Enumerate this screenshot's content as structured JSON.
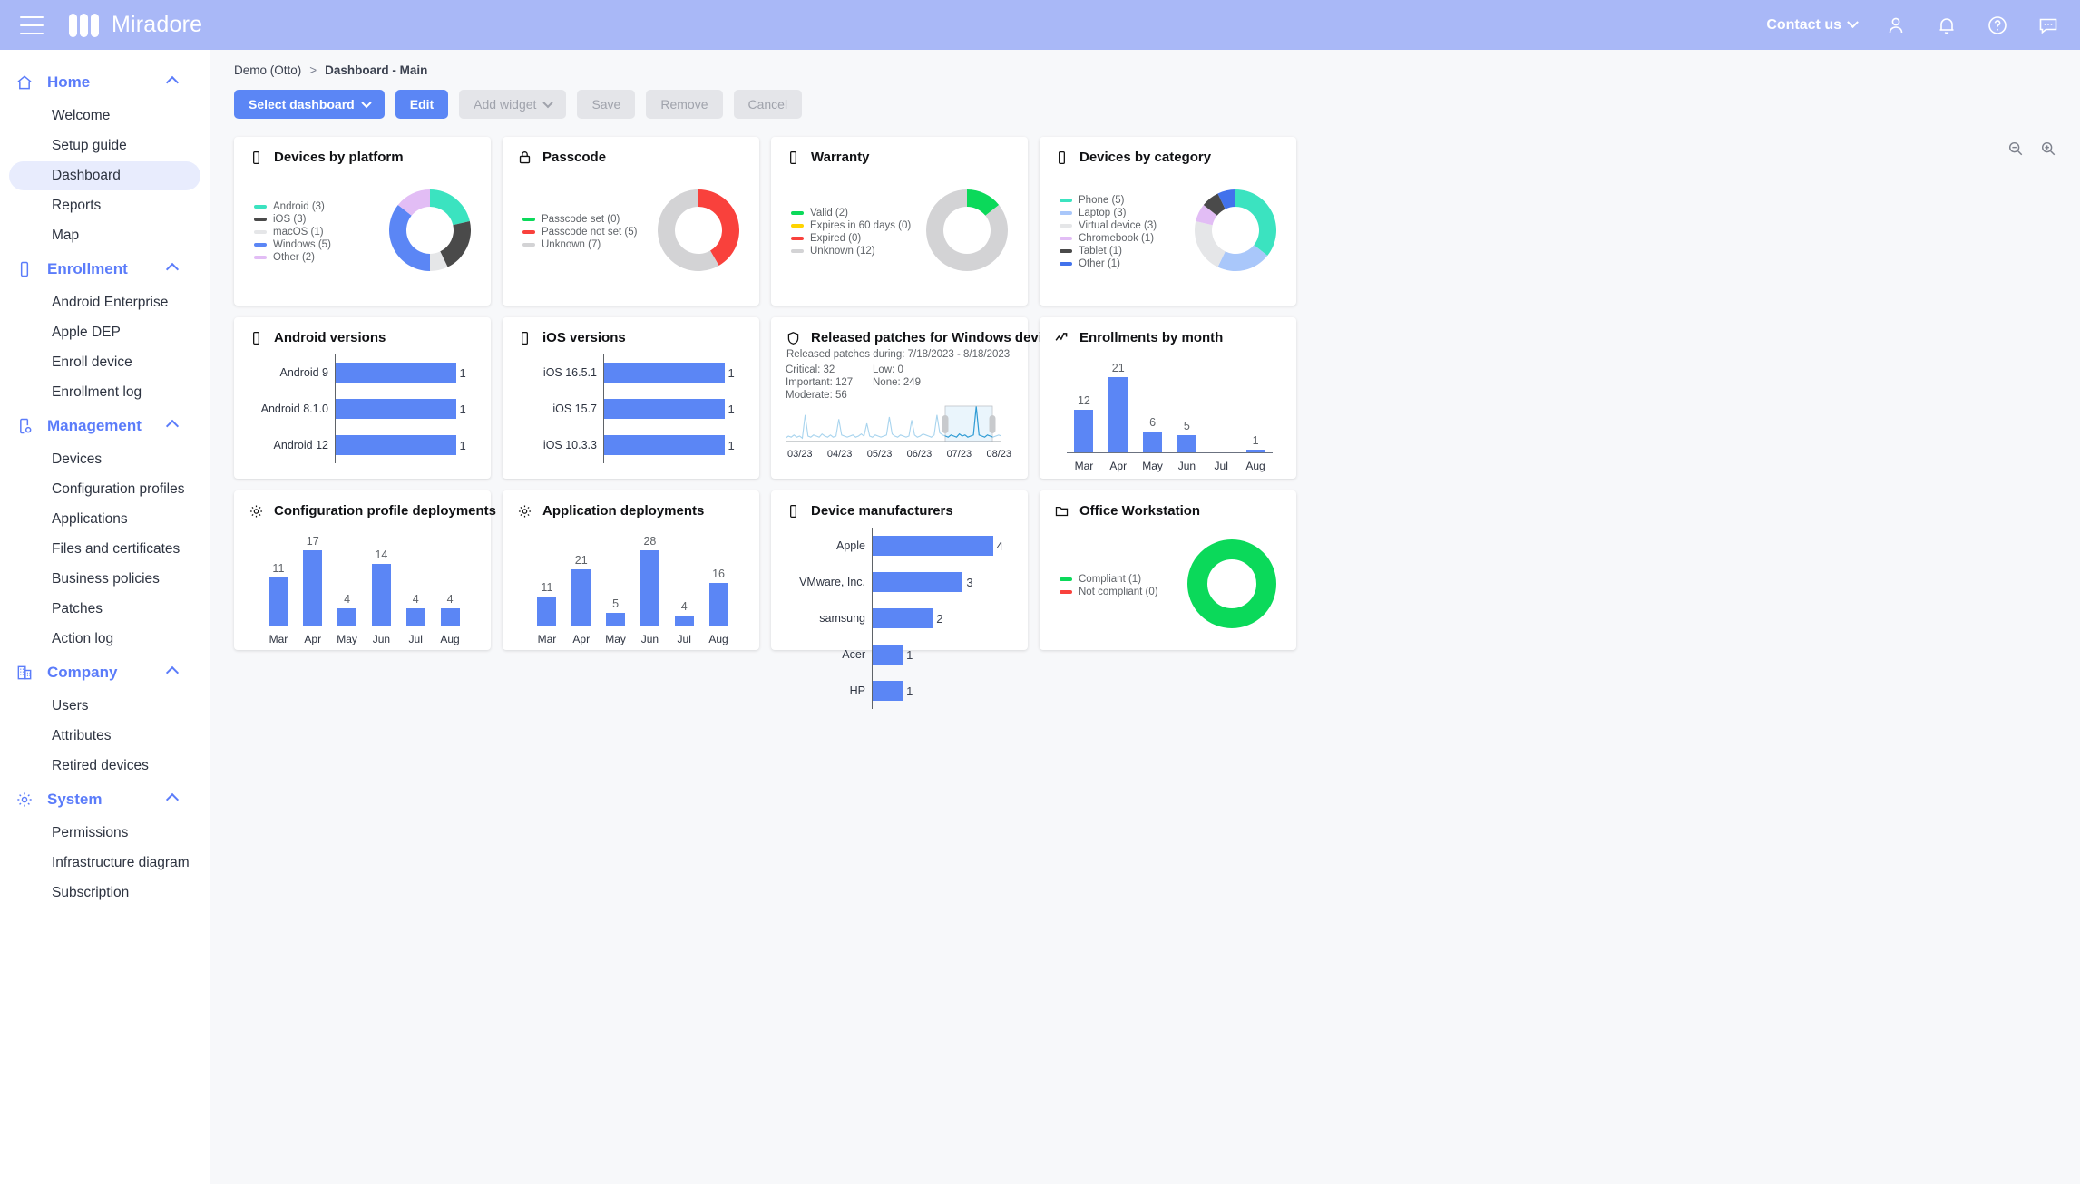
{
  "topbar": {
    "brand": "Miradore",
    "contact_label": "Contact us",
    "icons": [
      "menu-icon",
      "user-icon",
      "bell-icon",
      "help-icon",
      "chat-icon"
    ]
  },
  "sidebar": {
    "groups": [
      {
        "label": "Home",
        "icon": "home-icon",
        "items": [
          {
            "label": "Welcome",
            "active": false
          },
          {
            "label": "Setup guide",
            "active": false
          },
          {
            "label": "Dashboard",
            "active": true
          },
          {
            "label": "Reports",
            "active": false
          },
          {
            "label": "Map",
            "active": false
          }
        ]
      },
      {
        "label": "Enrollment",
        "icon": "device-icon",
        "items": [
          {
            "label": "Android Enterprise",
            "active": false
          },
          {
            "label": "Apple DEP",
            "active": false
          },
          {
            "label": "Enroll device",
            "active": false
          },
          {
            "label": "Enrollment log",
            "active": false
          }
        ]
      },
      {
        "label": "Management",
        "icon": "device-cog-icon",
        "items": [
          {
            "label": "Devices",
            "active": false
          },
          {
            "label": "Configuration profiles",
            "active": false
          },
          {
            "label": "Applications",
            "active": false
          },
          {
            "label": "Files and certificates",
            "active": false
          },
          {
            "label": "Business policies",
            "active": false
          },
          {
            "label": "Patches",
            "active": false
          },
          {
            "label": "Action log",
            "active": false
          }
        ]
      },
      {
        "label": "Company",
        "icon": "building-icon",
        "items": [
          {
            "label": "Users",
            "active": false
          },
          {
            "label": "Attributes",
            "active": false
          },
          {
            "label": "Retired devices",
            "active": false
          }
        ]
      },
      {
        "label": "System",
        "icon": "gear-icon",
        "items": [
          {
            "label": "Permissions",
            "active": false
          },
          {
            "label": "Infrastructure diagram",
            "active": false
          },
          {
            "label": "Subscription",
            "active": false
          }
        ]
      }
    ]
  },
  "breadcrumb": {
    "root": "Demo (Otto)",
    "separator": ">",
    "current": "Dashboard - Main"
  },
  "toolbar": {
    "select_dashboard": "Select dashboard",
    "edit": "Edit",
    "add_widget": "Add widget",
    "save": "Save",
    "remove": "Remove",
    "cancel": "Cancel",
    "zoom_out_icon": "zoom-out-icon",
    "zoom_in_icon": "zoom-in-icon"
  },
  "colors": {
    "brand_blue": "#5B86F5",
    "header_blue": "#A9B8F7",
    "teal": "#3BE3C0",
    "dark_gray": "#4A4A4A",
    "light_gray": "#E5E6E8",
    "violet": "#E2BDF5",
    "green": "#0BD95A",
    "red": "#F9413C",
    "yellow": "#FFD400",
    "lilac": "#A9C7FA"
  },
  "chart_data": [
    {
      "id": "devices-by-platform",
      "type": "pie",
      "title": "Devices by platform",
      "icon": "device-icon",
      "legend_position": "left",
      "labels": [
        "Android (3)",
        "iOS (3)",
        "macOS (1)",
        "Windows (5)",
        "Other (2)"
      ],
      "categories": [
        "Android",
        "iOS",
        "macOS",
        "Windows",
        "Other"
      ],
      "values": [
        3,
        3,
        1,
        5,
        2
      ],
      "colors": [
        "#3BE3C0",
        "#4A4A4A",
        "#E5E6E8",
        "#5B86F5",
        "#E2BDF5"
      ]
    },
    {
      "id": "passcode",
      "type": "pie",
      "title": "Passcode",
      "icon": "lock-icon",
      "legend_position": "left",
      "labels": [
        "Passcode set (0)",
        "Passcode not set (5)",
        "Unknown (7)"
      ],
      "categories": [
        "Passcode set",
        "Passcode not set",
        "Unknown"
      ],
      "values": [
        0,
        5,
        7
      ],
      "colors": [
        "#0BD95A",
        "#F9413C",
        "#D3D3D5"
      ]
    },
    {
      "id": "warranty",
      "type": "pie",
      "title": "Warranty",
      "icon": "device-icon",
      "legend_position": "left",
      "labels": [
        "Valid (2)",
        "Expires in 60 days (0)",
        "Expired (0)",
        "Unknown (12)"
      ],
      "categories": [
        "Valid",
        "Expires in 60 days",
        "Expired",
        "Unknown"
      ],
      "values": [
        2,
        0,
        0,
        12
      ],
      "colors": [
        "#0BD95A",
        "#FFD400",
        "#F9413C",
        "#D3D3D5"
      ]
    },
    {
      "id": "devices-by-category",
      "type": "pie",
      "title": "Devices by category",
      "icon": "device-icon",
      "legend_position": "left",
      "labels": [
        "Phone (5)",
        "Laptop (3)",
        "Virtual device (3)",
        "Chromebook (1)",
        "Tablet (1)",
        "Other (1)"
      ],
      "categories": [
        "Phone",
        "Laptop",
        "Virtual device",
        "Chromebook",
        "Tablet",
        "Other"
      ],
      "values": [
        5,
        3,
        3,
        1,
        1,
        1
      ],
      "colors": [
        "#3BE3C0",
        "#A9C7FA",
        "#E5E6E8",
        "#E2BDF5",
        "#4A4A4A",
        "#4272EC"
      ]
    },
    {
      "id": "android-versions",
      "type": "bar",
      "orientation": "horizontal",
      "title": "Android versions",
      "icon": "device-icon",
      "categories": [
        "Android 9",
        "Android 8.1.0",
        "Android 12"
      ],
      "values": [
        1,
        1,
        1
      ],
      "xlim": [
        0,
        1
      ],
      "color": "#5B86F5"
    },
    {
      "id": "ios-versions",
      "type": "bar",
      "orientation": "horizontal",
      "title": "iOS versions",
      "icon": "device-icon",
      "categories": [
        "iOS 16.5.1",
        "iOS 15.7",
        "iOS 10.3.3"
      ],
      "values": [
        1,
        1,
        1
      ],
      "xlim": [
        0,
        1
      ],
      "color": "#5B86F5"
    },
    {
      "id": "released-patches",
      "type": "area",
      "title": "Released patches for Windows devices",
      "icon": "shield-icon",
      "subtitle": "Released patches during: 7/18/2023 - 8/18/2023",
      "stats": [
        {
          "label": "Critical:",
          "value": "32"
        },
        {
          "label": "Low:",
          "value": "0"
        },
        {
          "label": "Important:",
          "value": "127"
        },
        {
          "label": "None:",
          "value": "249"
        },
        {
          "label": "Moderate:",
          "value": "56"
        }
      ],
      "tick_labels": [
        "03/23",
        "04/23",
        "05/23",
        "06/23",
        "07/23",
        "08/23"
      ],
      "selection_label": "7/18/2023 - 8/18/2023",
      "color": "#3DA5DE"
    },
    {
      "id": "enrollments-by-month",
      "type": "bar",
      "orientation": "vertical",
      "title": "Enrollments by month",
      "icon": "trend-icon",
      "categories": [
        "Mar",
        "Apr",
        "May",
        "Jun",
        "Jul",
        "Aug"
      ],
      "values": [
        12,
        21,
        6,
        5,
        0,
        1
      ],
      "ylim": [
        0,
        21
      ],
      "color": "#5B86F5"
    },
    {
      "id": "configuration-profile-deployments",
      "type": "bar",
      "orientation": "vertical",
      "title": "Configuration profile deployments",
      "icon": "gear-icon",
      "categories": [
        "Mar",
        "Apr",
        "May",
        "Jun",
        "Jul",
        "Aug"
      ],
      "values": [
        11,
        17,
        4,
        14,
        4,
        4
      ],
      "ylim": [
        0,
        17
      ],
      "color": "#5B86F5"
    },
    {
      "id": "application-deployments",
      "type": "bar",
      "orientation": "vertical",
      "title": "Application deployments",
      "icon": "gear-icon",
      "categories": [
        "Mar",
        "Apr",
        "May",
        "Jun",
        "Jul",
        "Aug"
      ],
      "values": [
        11,
        21,
        5,
        28,
        4,
        16
      ],
      "ylim": [
        0,
        28
      ],
      "color": "#5B86F5"
    },
    {
      "id": "device-manufacturers",
      "type": "bar",
      "orientation": "horizontal",
      "title": "Device manufacturers",
      "icon": "device-icon",
      "categories": [
        "Apple",
        "VMware, Inc.",
        "samsung",
        "Acer",
        "HP"
      ],
      "values": [
        4,
        3,
        2,
        1,
        1
      ],
      "xlim": [
        0,
        4
      ],
      "color": "#5B86F5"
    },
    {
      "id": "office-workstation",
      "type": "pie",
      "title": "Office Workstation",
      "icon": "folder-icon",
      "legend_position": "left",
      "labels": [
        "Compliant (1)",
        "Not compliant (0)"
      ],
      "categories": [
        "Compliant",
        "Not compliant"
      ],
      "values": [
        1,
        0
      ],
      "colors": [
        "#0BD95A",
        "#F9413C"
      ]
    }
  ]
}
